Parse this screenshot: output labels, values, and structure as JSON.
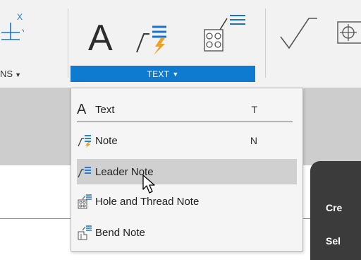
{
  "toolbar": {
    "dims_group_label": "NS",
    "dims_dropdown_icon": "caret-down-icon",
    "axis_x_label": "X",
    "axis_y_label": "Y",
    "text_group_label": "TEXT",
    "text_dropdown_icon": "caret-down-icon",
    "big_text_tool_glyph": "A",
    "tools": [
      "text-tool-icon",
      "note-tool-icon",
      "hole-note-tool-icon",
      "surface-texture-icon",
      "feature-control-frame-icon"
    ]
  },
  "menu": {
    "items": [
      {
        "label": "Text",
        "shortcut": "T",
        "icon": "text-A-icon",
        "glyph": "A"
      },
      {
        "label": "Note",
        "shortcut": "N",
        "icon": "note-icon"
      },
      {
        "label": "Leader Note",
        "shortcut": "",
        "icon": "leader-note-icon"
      },
      {
        "label": "Hole and Thread Note",
        "shortcut": "",
        "icon": "hole-thread-note-icon"
      },
      {
        "label": "Bend Note",
        "shortcut": "",
        "icon": "bend-note-icon"
      }
    ],
    "hovered_index": 2
  },
  "panel": {
    "line1": "Cre",
    "line2": "Sel"
  },
  "colors": {
    "accent": "#0f7bd0",
    "toolbar_bg": "#f2f2f2",
    "menu_bg": "#f5f5f5",
    "hover_bg": "#d0d0d0",
    "note_orange": "#f0a020",
    "icon_blue": "#1a73c8"
  }
}
